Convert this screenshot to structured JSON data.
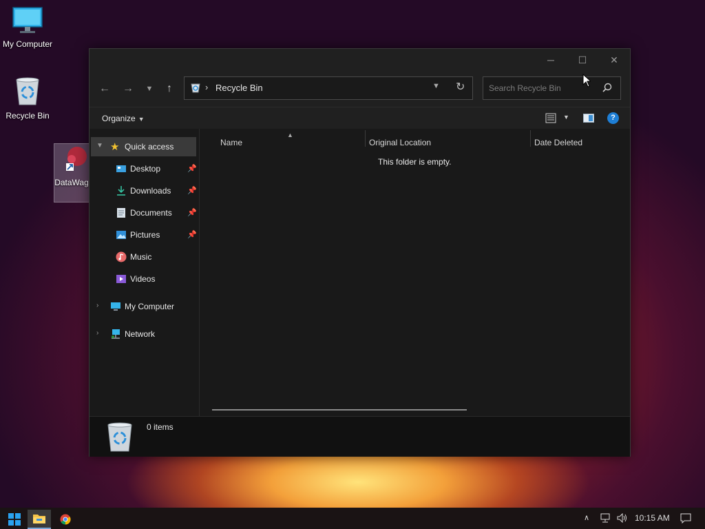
{
  "desktop": {
    "icons": [
      {
        "label": "My Computer"
      },
      {
        "label": "Recycle Bin"
      },
      {
        "label": "DataWag om"
      }
    ]
  },
  "window": {
    "controls": {
      "minimize": "─",
      "maximize": "☐",
      "close": "✕"
    },
    "address": {
      "path": [
        "Recycle Bin"
      ],
      "separator": "›"
    },
    "search": {
      "placeholder": "Search Recycle Bin"
    },
    "toolbar": {
      "organize_label": "Organize"
    },
    "nav_pane": {
      "quick_access": "Quick access",
      "quick_items": [
        {
          "label": "Desktop",
          "pinned": true
        },
        {
          "label": "Downloads",
          "pinned": true
        },
        {
          "label": "Documents",
          "pinned": true
        },
        {
          "label": "Pictures",
          "pinned": true
        },
        {
          "label": "Music",
          "pinned": false
        },
        {
          "label": "Videos",
          "pinned": false
        }
      ],
      "roots": [
        {
          "label": "My Computer"
        },
        {
          "label": "Network"
        }
      ]
    },
    "content": {
      "columns": [
        "Name",
        "Original Location",
        "Date Deleted"
      ],
      "empty_message": "This folder is empty."
    },
    "status": {
      "item_count": "0 items"
    }
  },
  "taskbar": {
    "clock": "10:15 AM"
  },
  "colors": {
    "accent": "#1e7fd6",
    "window_bg": "#191919",
    "toolbar_bg": "#202020",
    "selection": "#3a3a3a"
  }
}
